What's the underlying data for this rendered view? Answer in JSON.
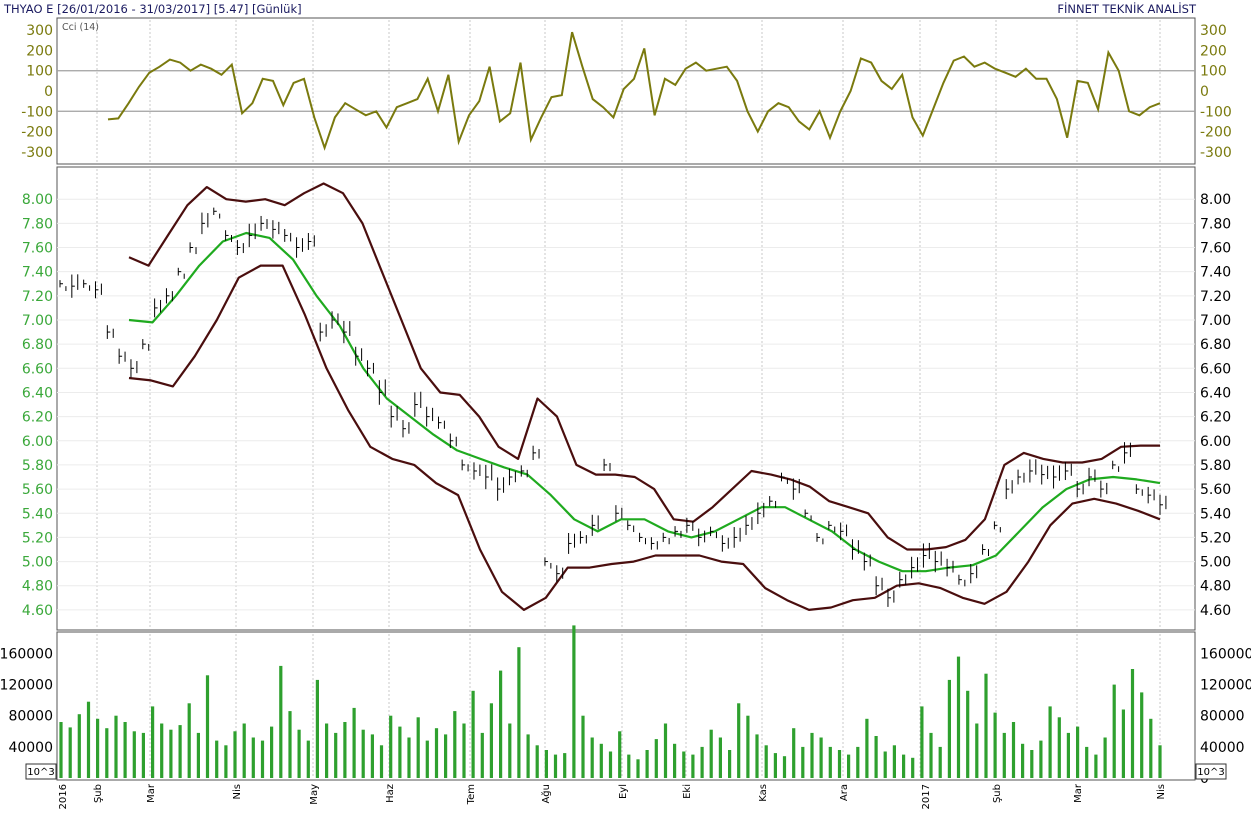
{
  "header": {
    "title": "THYAO E  [26/01/2016 - 31/03/2017]  [5.47]  [Günlük]",
    "brand": "FİNNET TEKNİK ANALİST"
  },
  "colors": {
    "cci_line": "#7a7a0e",
    "price_axis_left": "#3aa83a",
    "bollinger_band": "#4a0e0e",
    "bollinger_mid": "#1faa1f",
    "price_bar": "#000000",
    "volume_bar": "#2ea02e",
    "grid": "#c8c8c8",
    "reference_line": "#a0a0a0"
  },
  "chart_data": [
    {
      "type": "line",
      "name": "cci",
      "panel_label": "Cci (14)",
      "ylim": [
        -350,
        350
      ],
      "yticks": [
        300,
        200,
        100,
        0,
        -100,
        -200,
        -300
      ],
      "ytick_labels": [
        "300",
        "200",
        "100",
        "0",
        "-100",
        "-200",
        "-300"
      ],
      "reference_levels": [
        100,
        -100
      ],
      "x_months": [
        0.9,
        2.1,
        3.0,
        4.1,
        5.0,
        6.0,
        7.1,
        8.1,
        9.0,
        10.1,
        11.0,
        12.0,
        13.0,
        14.1
      ],
      "values": [
        -140,
        -135,
        -60,
        20,
        90,
        120,
        155,
        140,
        100,
        130,
        110,
        80,
        130,
        -110,
        -60,
        60,
        50,
        -70,
        40,
        60,
        -130,
        -280,
        -130,
        -60,
        -90,
        -120,
        -100,
        -180,
        -80,
        -60,
        -40,
        60,
        -100,
        80,
        -250,
        -120,
        -50,
        120,
        -150,
        -110,
        140,
        -240,
        -130,
        -30,
        -20,
        290,
        120,
        -40,
        -80,
        -130,
        10,
        60,
        210,
        -120,
        60,
        30,
        110,
        140,
        100,
        110,
        120,
        50,
        -100,
        -200,
        -100,
        -60,
        -80,
        -150,
        -190,
        -100,
        -230,
        -100,
        0,
        160,
        140,
        50,
        10,
        80,
        -130,
        -220,
        -90,
        40,
        150,
        170,
        120,
        140,
        110,
        90,
        70,
        110,
        60,
        60,
        -40,
        -230,
        50,
        40,
        -90,
        190,
        100,
        -100,
        -120,
        -80,
        -60
      ]
    },
    {
      "type": "line",
      "name": "price",
      "ylim": [
        4.45,
        8.25
      ],
      "yticks": [
        8.0,
        7.8,
        7.6,
        7.4,
        7.2,
        7.0,
        6.8,
        6.6,
        6.4,
        6.2,
        6.0,
        5.8,
        5.6,
        5.4,
        5.2,
        5.0,
        4.8,
        4.6
      ],
      "ytick_labels": [
        "8.00",
        "7.80",
        "7.60",
        "7.40",
        "7.20",
        "7.00",
        "6.80",
        "6.60",
        "6.40",
        "6.20",
        "6.00",
        "5.80",
        "5.60",
        "5.40",
        "5.20",
        "5.00",
        "4.80",
        "4.60"
      ],
      "close": [
        7.3,
        7.28,
        7.3,
        7.25,
        6.9,
        6.7,
        6.6,
        6.8,
        7.1,
        7.2,
        7.4,
        7.6,
        7.8,
        7.9,
        7.7,
        7.6,
        7.7,
        7.8,
        7.75,
        7.7,
        7.6,
        7.65,
        6.9,
        7.0,
        6.9,
        6.7,
        6.6,
        6.4,
        6.2,
        6.1,
        6.3,
        6.2,
        6.15,
        6.0,
        5.8,
        5.75,
        5.7,
        5.6,
        5.7,
        5.75,
        5.9,
        5.0,
        4.9,
        5.15,
        5.2,
        5.3,
        5.8,
        5.4,
        5.3,
        5.2,
        5.15,
        5.2,
        5.25,
        5.3,
        5.2,
        5.25,
        5.15,
        5.2,
        5.3,
        5.4,
        5.5,
        5.7,
        5.6,
        5.4,
        5.2,
        5.3,
        5.25,
        5.1,
        5.0,
        4.8,
        4.7,
        4.85,
        4.95,
        5.05,
        5.0,
        4.95,
        4.85,
        4.9,
        5.1,
        5.3,
        5.6,
        5.7,
        5.75,
        5.72,
        5.7,
        5.75,
        5.6,
        5.7,
        5.6,
        5.8,
        5.9,
        5.6,
        5.55,
        5.47
      ],
      "bollinger_upper": [
        7.52,
        7.45,
        7.7,
        7.95,
        8.1,
        8.0,
        7.98,
        8.0,
        7.95,
        8.05,
        8.13,
        8.05,
        7.8,
        7.4,
        7.0,
        6.6,
        6.4,
        6.38,
        6.2,
        5.95,
        5.85,
        6.35,
        6.2,
        5.8,
        5.72,
        5.72,
        5.7,
        5.6,
        5.35,
        5.33,
        5.45,
        5.6,
        5.75,
        5.72,
        5.68,
        5.62,
        5.5,
        5.45,
        5.4,
        5.2,
        5.1,
        5.1,
        5.12,
        5.18,
        5.35,
        5.8,
        5.9,
        5.85,
        5.82,
        5.82,
        5.85,
        5.95,
        5.96,
        5.96
      ],
      "bollinger_middle": [
        7.0,
        6.98,
        7.2,
        7.45,
        7.65,
        7.72,
        7.68,
        7.5,
        7.2,
        6.95,
        6.6,
        6.35,
        6.2,
        6.05,
        5.92,
        5.85,
        5.78,
        5.72,
        5.55,
        5.35,
        5.25,
        5.35,
        5.35,
        5.25,
        5.2,
        5.25,
        5.35,
        5.45,
        5.45,
        5.35,
        5.25,
        5.1,
        5.0,
        4.92,
        4.92,
        4.95,
        4.97,
        5.05,
        5.25,
        5.45,
        5.6,
        5.68,
        5.7,
        5.68,
        5.65
      ],
      "bollinger_lower": [
        6.52,
        6.5,
        6.45,
        6.7,
        7.0,
        7.35,
        7.45,
        7.45,
        7.05,
        6.6,
        6.25,
        5.95,
        5.85,
        5.8,
        5.65,
        5.55,
        5.1,
        4.75,
        4.6,
        4.7,
        4.95,
        4.95,
        4.98,
        5.0,
        5.05,
        5.05,
        5.05,
        5.0,
        4.98,
        4.78,
        4.68,
        4.6,
        4.62,
        4.68,
        4.7,
        4.8,
        4.82,
        4.78,
        4.7,
        4.65,
        4.75,
        5.0,
        5.3,
        5.48,
        5.52,
        5.48,
        5.42,
        5.35
      ]
    },
    {
      "type": "bar",
      "name": "volume",
      "unit_label": "10^3",
      "ylim": [
        0,
        185000
      ],
      "yticks": [
        160000,
        120000,
        80000,
        40000,
        0
      ],
      "ytick_labels": [
        "160000",
        "120000",
        "80000",
        "40000",
        "0"
      ],
      "left_ytick_labels": [
        "160000",
        "120000",
        "80000",
        "40000"
      ],
      "values": [
        72000,
        65000,
        82000,
        98000,
        76000,
        64000,
        80000,
        72000,
        60000,
        58000,
        92000,
        70000,
        62000,
        68000,
        96000,
        58000,
        132000,
        48000,
        42000,
        60000,
        70000,
        52000,
        48000,
        66000,
        144000,
        86000,
        62000,
        48000,
        126000,
        70000,
        58000,
        72000,
        90000,
        62000,
        56000,
        42000,
        80000,
        66000,
        52000,
        78000,
        48000,
        64000,
        56000,
        86000,
        70000,
        112000,
        58000,
        96000,
        138000,
        70000,
        168000,
        56000,
        42000,
        36000,
        30000,
        32000,
        196000,
        80000,
        52000,
        44000,
        34000,
        60000,
        30000,
        24000,
        36000,
        50000,
        70000,
        44000,
        34000,
        30000,
        40000,
        62000,
        52000,
        36000,
        96000,
        80000,
        56000,
        42000,
        32000,
        28000,
        64000,
        40000,
        58000,
        52000,
        40000,
        36000,
        30000,
        40000,
        76000,
        54000,
        34000,
        42000,
        30000,
        26000,
        92000,
        58000,
        40000,
        126000,
        156000,
        112000,
        70000,
        134000,
        84000,
        58000,
        72000,
        44000,
        36000,
        48000,
        92000,
        78000,
        58000,
        66000,
        40000,
        30000,
        52000,
        120000,
        88000,
        140000,
        110000,
        76000,
        42000
      ]
    }
  ],
  "x_axis": {
    "year_start": "2016",
    "year_mid": "2017",
    "months": [
      "Şub",
      "Mar",
      "Nis",
      "May",
      "Haz",
      "Tem",
      "Ağu",
      "Eyl",
      "Eki",
      "Kas",
      "Ara",
      "Şub",
      "Mar",
      "Nis"
    ]
  }
}
